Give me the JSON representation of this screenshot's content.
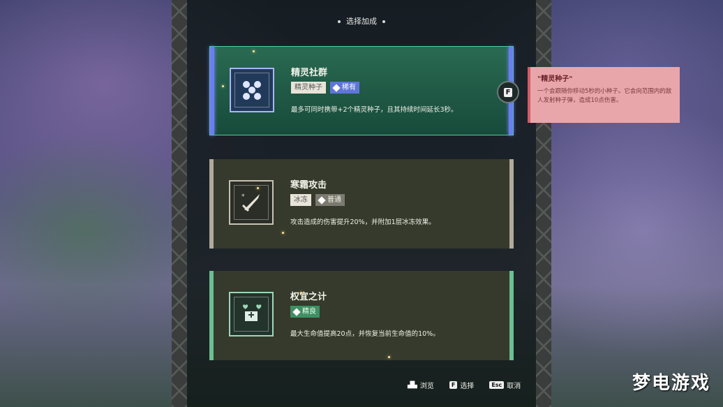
{
  "header": {
    "title": "选择加成"
  },
  "cards": [
    {
      "name": "精灵社群",
      "icon": "sprite-group-icon",
      "tags": [
        {
          "label": "精灵种子",
          "style": "plain"
        },
        {
          "label": "稀有",
          "style": "rare"
        }
      ],
      "description": "最多可同时携带+2个精灵种子，且其持续时间延长3秒。",
      "selected": true
    },
    {
      "name": "寒霜攻击",
      "icon": "frost-sword-icon",
      "tags": [
        {
          "label": "冰冻",
          "style": "plain"
        },
        {
          "label": "普通",
          "style": "common"
        }
      ],
      "description": "攻击造成的伤害提升20%，并附加1层冰冻效果。",
      "selected": false
    },
    {
      "name": "权宜之计",
      "icon": "heart-chest-icon",
      "tags": [
        {
          "label": "精良",
          "style": "good"
        }
      ],
      "description": "最大生命值提高20点，并恢复当前生命值的10%。",
      "selected": false
    }
  ],
  "select_key": "F",
  "tooltip": {
    "title": "\"精灵种子\"",
    "body": "一个会跟随你移动5秒的小种子。它会向范围内的敌人发射种子弹，造成10点伤害。"
  },
  "footer": {
    "browse": "浏览",
    "select_key": "F",
    "select": "选择",
    "cancel_key": "Esc",
    "cancel": "取消"
  },
  "watermark": "梦电游戏",
  "colors": {
    "selected_accent": "#6a7ef0",
    "rare_tag": "#5f76d8",
    "good_tag": "#3f8f62",
    "tooltip_bg": "#e8a6aa"
  }
}
